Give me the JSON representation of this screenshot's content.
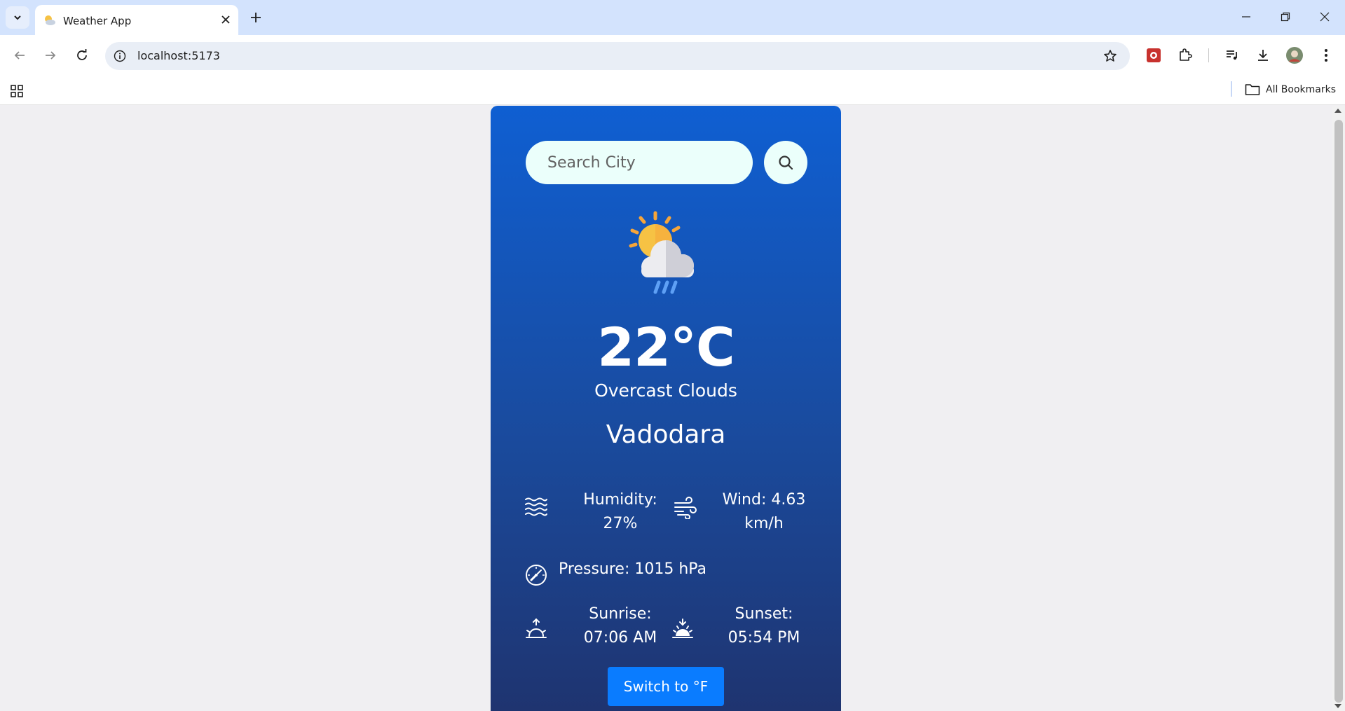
{
  "browser": {
    "tab_title": "Weather App",
    "url": "localhost:5173",
    "bookmarks_label": "All Bookmarks"
  },
  "weather": {
    "search_placeholder": "Search City",
    "temperature": "22°C",
    "description": "Overcast Clouds",
    "city": "Vadodara",
    "humidity_label": "Humidity:",
    "humidity_value": "27%",
    "wind_label": "Wind: 4.63",
    "wind_unit": "km/h",
    "pressure": "Pressure: 1015 hPa",
    "sunrise_label": "Sunrise:",
    "sunrise_time": "07:06 AM",
    "sunset_label": "Sunset:",
    "sunset_time": "05:54 PM",
    "switch_label": "Switch to °F"
  },
  "colors": {
    "card_gradient_top": "#0f5fd2",
    "card_gradient_bottom": "#1f336e",
    "button_blue": "#0a7cff",
    "input_bg": "#ebfffb"
  }
}
